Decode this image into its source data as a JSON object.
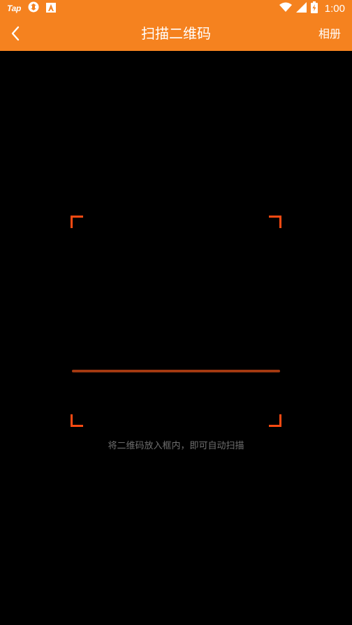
{
  "statusbar": {
    "app_logo": "Tap",
    "time": "1:00",
    "icons": [
      "tap-logo",
      "sync-icon",
      "a-icon",
      "wifi-icon",
      "signal-icon",
      "battery-icon"
    ]
  },
  "appbar": {
    "back_icon": "chevron-left-icon",
    "title": "扫描二维码",
    "album_label": "相册"
  },
  "scanner": {
    "hint": "将二维码放入框内，即可自动扫描"
  },
  "colors": {
    "topbar": "#F5821F",
    "corner": "#FF4A12",
    "background": "#000000",
    "hint_text": "#6F6F6F"
  }
}
